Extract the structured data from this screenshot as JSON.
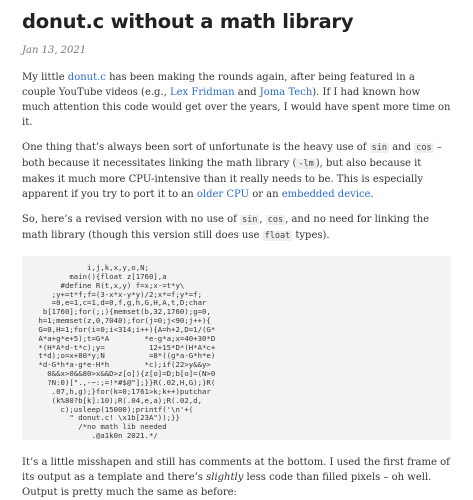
{
  "title": "donut.c without a math library",
  "date": "Jan 13, 2021",
  "p1": {
    "t1": "My little ",
    "link_donut": "donut.c",
    "t2": " has been making the rounds again, after being featured in a couple YouTube videos (e.g., ",
    "link_lex": "Lex Fridman",
    "t3": " and ",
    "link_joma": "Joma Tech",
    "t4": "). If I had known how much attention this code would get over the years, I would have spent more time on it."
  },
  "p2": {
    "t1": "One thing that’s always been sort of unfortunate is the heavy use of ",
    "code_sin": "sin",
    "t2": " and ",
    "code_cos": "cos",
    "t3": " – both because it necessitates linking the math library (",
    "code_lm": "-lm",
    "t4": "), but also because it makes it much more CPU-intensive than it really needs to be. This is especially apparent if you try to port it to an ",
    "link_cpu": "older CPU",
    "t5": " or an ",
    "link_embedded": "embedded device",
    "t6": "."
  },
  "p3": {
    "t1": "So, here’s a revised version with no use of ",
    "code_sin": "sin",
    "t2": ", ",
    "code_cos": "cos",
    "t3": ", and no need for linking the math library (though this version still does use ",
    "code_float": "float",
    "t4": " types)."
  },
  "code_block": "            i,j,k,x,y,o,N;\n        main(){float z[1760],a\n      #define R(t,x,y) f=x;x-=t*y\\\n    ;y+=t*f;f=(3-x*x-y*y)/2;x*=f;y*=f;\n    =0,e=1,c=1,d=0,f,g,h,G,H,A,t,D;char\n  b[1760];for(;;){memset(b,32,1760);g=0,\n h=1;memset(z,0,7040);for(j=0;j<90;j++){\n G=0,H=1;for(i=0;i<314;i++){A=h+2,D=1/(G*\n A*a+g*e+5);t=G*A        *e-g*a;x=40+30*D\n *(H*A*d-t*c);y=          12+15*D*(H*A*c+\n t*d);o=x+80*y;N          =8*((g*a-G*h*e)\n *d-G*h*a-g*e-H*h        *c);if(22>y&&y>\n   0&&x>0&&80>x&&D>z[o]){z[o]=D;b[o]=(N>0\n   ?N:0)[\".,-~:;=!*#$@\"];}}R(.02,H,G);}R(\n    .07,h,g);}for(k=0;1761>k;k++)putchar\n    (k%80?b[k]:10);R(.04,e,a);R(.02,d,\n      c);usleep(15000);printf('\\n'+(\n        \" donut.c! \\x1b[23A\"));}}\n          /*no math lib needed\n             .@a1k0n 2021.*/",
  "p4": {
    "t1": "It’s a little misshapen and still has comments at the bottom. I used the first frame of its output as a template and there’s ",
    "em": "slightly",
    "t2": " less code than filled pixels – oh well. Output is pretty much the same as before:"
  }
}
